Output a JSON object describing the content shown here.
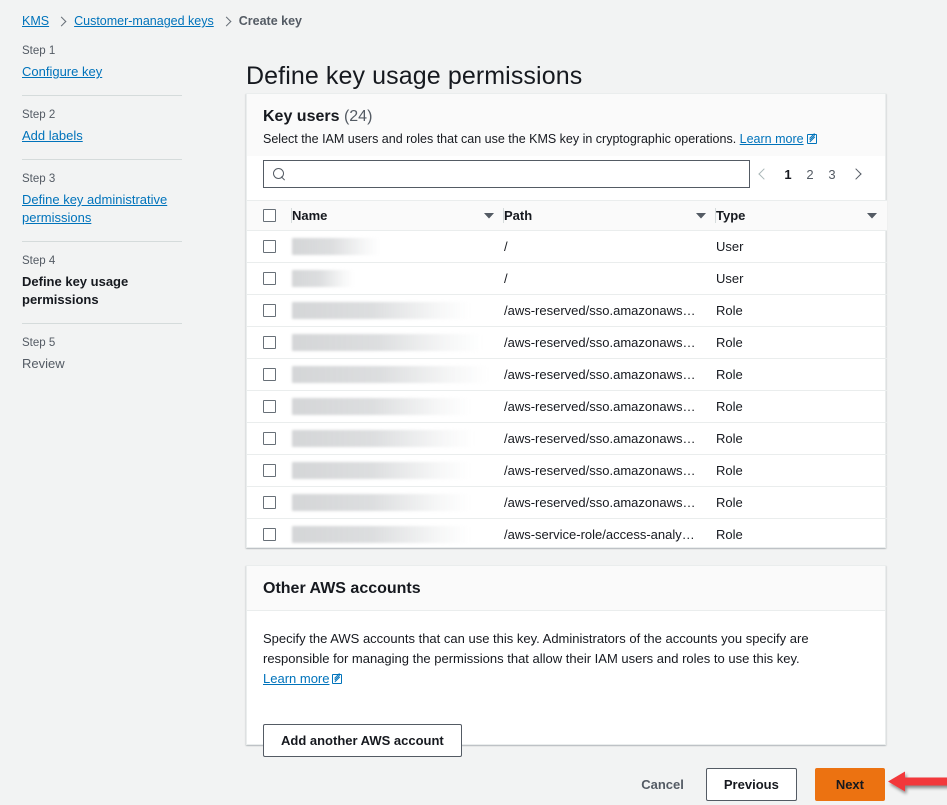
{
  "breadcrumb": {
    "items": [
      {
        "label": "KMS",
        "type": "link"
      },
      {
        "label": "Customer-managed keys",
        "type": "link"
      },
      {
        "label": "Create key",
        "type": "current"
      }
    ]
  },
  "sidebar": {
    "steps": [
      {
        "num": "Step 1",
        "name": "Configure key",
        "state": "link"
      },
      {
        "num": "Step 2",
        "name": "Add labels",
        "state": "link"
      },
      {
        "num": "Step 3",
        "name": "Define key administrative permissions",
        "state": "link"
      },
      {
        "num": "Step 4",
        "name": "Define key usage permissions",
        "state": "active"
      },
      {
        "num": "Step 5",
        "name": "Review",
        "state": "plain"
      }
    ]
  },
  "page": {
    "title": "Define key usage permissions"
  },
  "key_users": {
    "title": "Key users",
    "count": "(24)",
    "description": "Select the IAM users and roles that can use the KMS key in cryptographic operations.",
    "learn_more": "Learn more",
    "search": {
      "value": "",
      "placeholder": ""
    },
    "pagination": {
      "pages": [
        "1",
        "2",
        "3"
      ],
      "active": "1"
    },
    "columns": [
      "Name",
      "Path",
      "Type"
    ],
    "rows": [
      {
        "name": "",
        "redacted": true,
        "redact_width": 88,
        "path": "/",
        "type": "User"
      },
      {
        "name": "",
        "redacted": true,
        "redact_width": 62,
        "path": "/",
        "type": "User"
      },
      {
        "name": "",
        "redacted": true,
        "redact_width": 178,
        "path": "/aws-reserved/sso.amazonaws…",
        "type": "Role"
      },
      {
        "name": "",
        "redacted": true,
        "redact_width": 190,
        "path": "/aws-reserved/sso.amazonaws…",
        "type": "Role"
      },
      {
        "name": "",
        "redacted": true,
        "redact_width": 196,
        "path": "/aws-reserved/sso.amazonaws…",
        "type": "Role"
      },
      {
        "name": "",
        "redacted": true,
        "redact_width": 178,
        "path": "/aws-reserved/sso.amazonaws…",
        "type": "Role"
      },
      {
        "name": "",
        "redacted": true,
        "redact_width": 182,
        "path": "/aws-reserved/sso.amazonaws…",
        "type": "Role"
      },
      {
        "name": "",
        "redacted": true,
        "redact_width": 178,
        "path": "/aws-reserved/sso.amazonaws…",
        "type": "Role"
      },
      {
        "name": "",
        "redacted": true,
        "redact_width": 178,
        "path": "/aws-reserved/sso.amazonaws…",
        "type": "Role"
      },
      {
        "name": "",
        "redacted": true,
        "redact_width": 178,
        "path": "/aws-service-role/access-analy…",
        "type": "Role"
      }
    ]
  },
  "other_accounts": {
    "title": "Other AWS accounts",
    "description_part1": "Specify the AWS accounts that can use this key. Administrators of the accounts you specify are responsible for managing the permissions that allow their IAM users and roles to use this key.",
    "learn_more": "Learn more",
    "add_button": "Add another AWS account"
  },
  "footer": {
    "cancel": "Cancel",
    "previous": "Previous",
    "next": "Next"
  },
  "annotation": {
    "arrow_color": "#f2383a",
    "direction": "left"
  },
  "colors": {
    "accent_link": "#0073bb",
    "primary_button": "#ec7211",
    "page_background": "#f2f3f3",
    "card_background": "#ffffff"
  }
}
